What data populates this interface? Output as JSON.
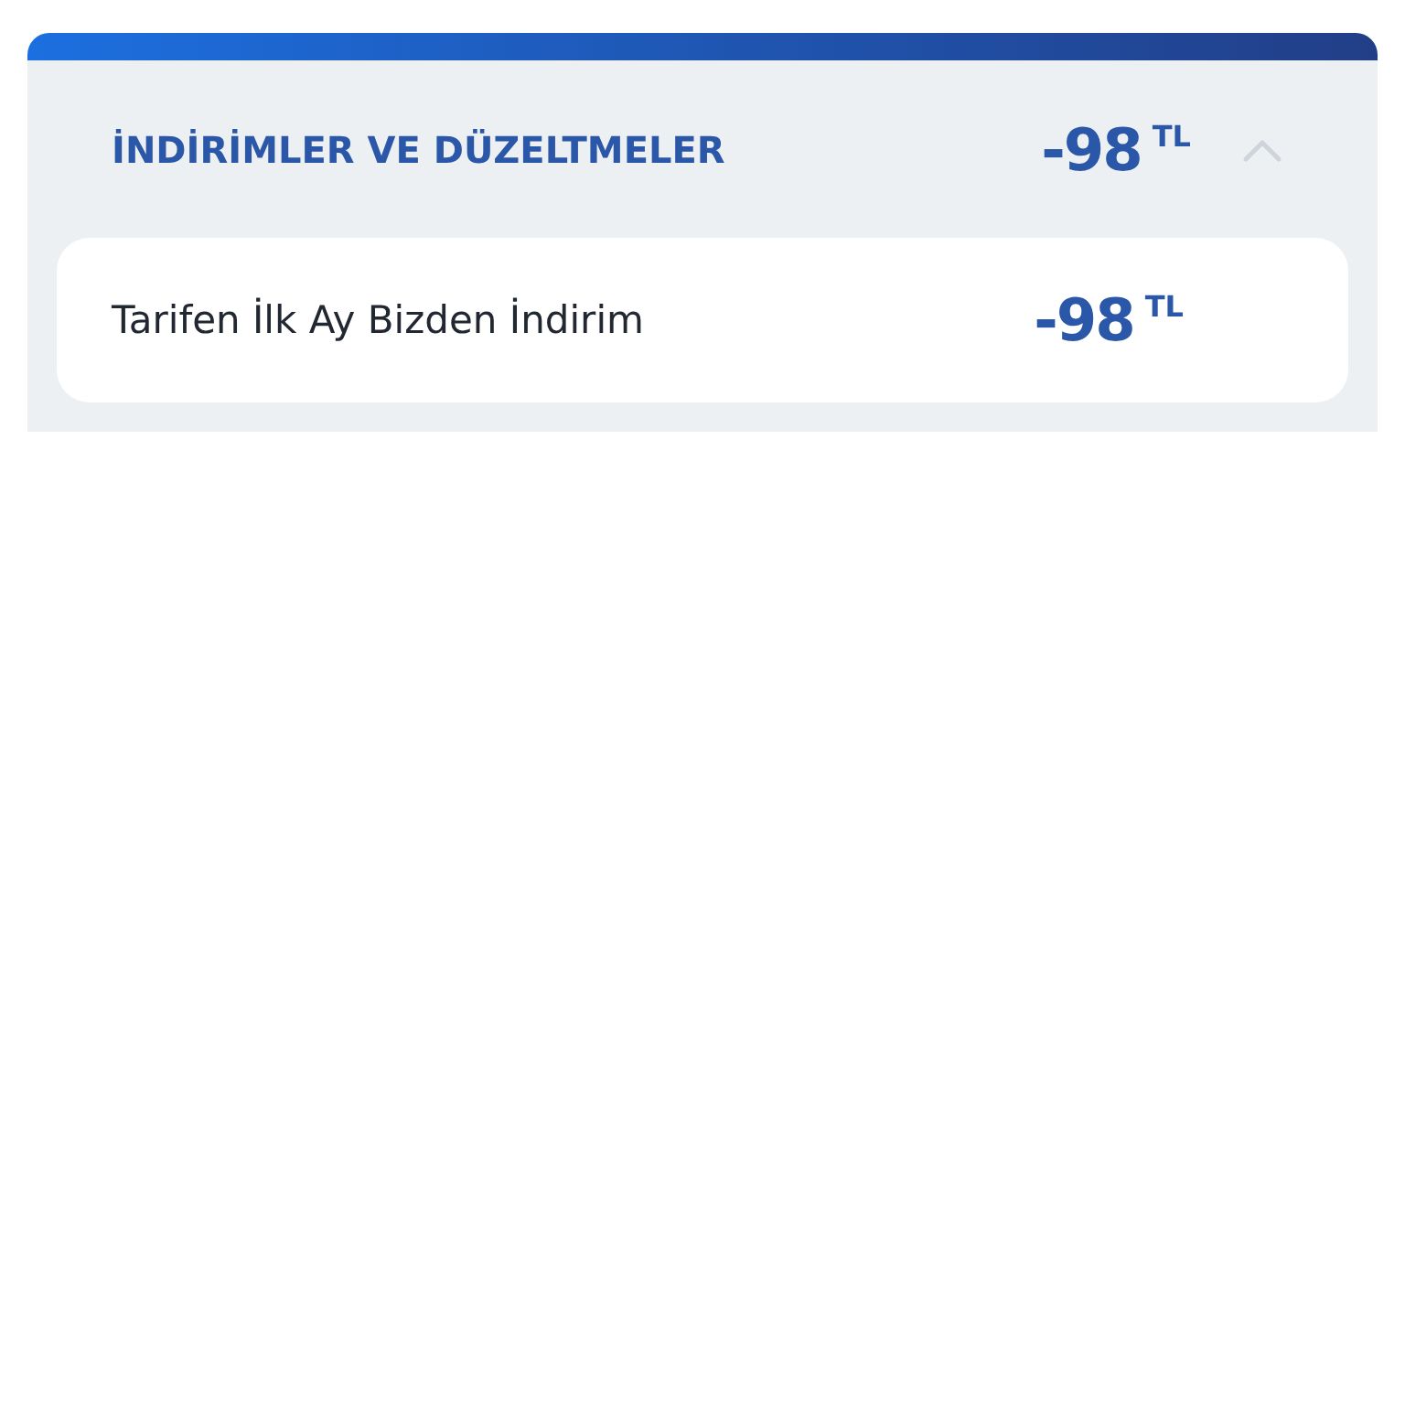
{
  "section": {
    "title": "İNDİRİMLER VE DÜZELTMELER",
    "amount": "-98",
    "currency": "TL",
    "expanded": true,
    "items": [
      {
        "label": "Tarifen İlk Ay Bizden İndirim",
        "amount": "-98",
        "currency": "TL"
      }
    ]
  }
}
